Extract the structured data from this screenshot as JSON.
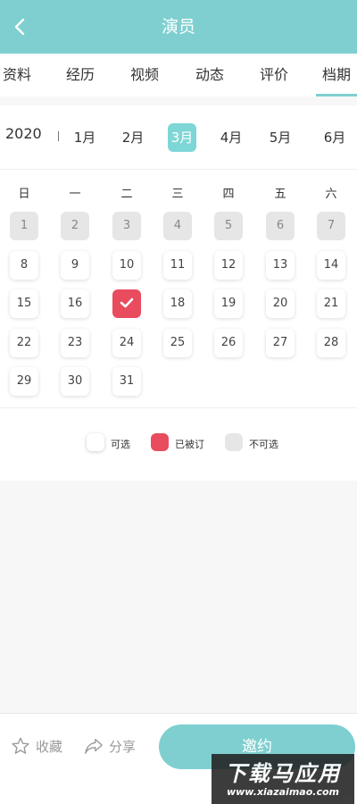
{
  "header": {
    "title": "演员",
    "back_icon": "chevron-left-icon"
  },
  "tabs": [
    {
      "label": "资料",
      "active": false
    },
    {
      "label": "经历",
      "active": false
    },
    {
      "label": "视频",
      "active": false
    },
    {
      "label": "动态",
      "active": false
    },
    {
      "label": "评价",
      "active": false
    },
    {
      "label": "档期",
      "active": true
    }
  ],
  "calendar": {
    "year": "2020",
    "months": [
      "1月",
      "2月",
      "3月",
      "4月",
      "5月",
      "6月"
    ],
    "active_month": "3月",
    "weekdays": [
      "日",
      "一",
      "二",
      "三",
      "四",
      "五",
      "六"
    ],
    "days": [
      {
        "d": "1",
        "s": "unavailable"
      },
      {
        "d": "2",
        "s": "unavailable"
      },
      {
        "d": "3",
        "s": "unavailable"
      },
      {
        "d": "4",
        "s": "unavailable"
      },
      {
        "d": "5",
        "s": "unavailable"
      },
      {
        "d": "6",
        "s": "unavailable"
      },
      {
        "d": "7",
        "s": "unavailable"
      },
      {
        "d": "8",
        "s": "available"
      },
      {
        "d": "9",
        "s": "available"
      },
      {
        "d": "10",
        "s": "available"
      },
      {
        "d": "11",
        "s": "available"
      },
      {
        "d": "12",
        "s": "available"
      },
      {
        "d": "13",
        "s": "available"
      },
      {
        "d": "14",
        "s": "available"
      },
      {
        "d": "15",
        "s": "available"
      },
      {
        "d": "16",
        "s": "available"
      },
      {
        "d": "17",
        "s": "booked"
      },
      {
        "d": "18",
        "s": "available"
      },
      {
        "d": "19",
        "s": "available"
      },
      {
        "d": "20",
        "s": "available"
      },
      {
        "d": "21",
        "s": "available"
      },
      {
        "d": "22",
        "s": "available"
      },
      {
        "d": "23",
        "s": "available"
      },
      {
        "d": "24",
        "s": "available"
      },
      {
        "d": "25",
        "s": "available"
      },
      {
        "d": "26",
        "s": "available"
      },
      {
        "d": "27",
        "s": "available"
      },
      {
        "d": "28",
        "s": "available"
      },
      {
        "d": "29",
        "s": "available"
      },
      {
        "d": "30",
        "s": "available"
      },
      {
        "d": "31",
        "s": "available"
      }
    ]
  },
  "legend": {
    "available": "可选",
    "booked": "已被订",
    "unavailable": "不可选"
  },
  "bottom": {
    "favorite": "收藏",
    "share": "分享",
    "invite": "邀约"
  },
  "watermark": {
    "line1": "下载马应用",
    "line2": "www.xiazaimao.com"
  },
  "colors": {
    "accent": "#7fcfd0",
    "booked": "#e84c5e",
    "unavailable": "#e6e6e6"
  }
}
